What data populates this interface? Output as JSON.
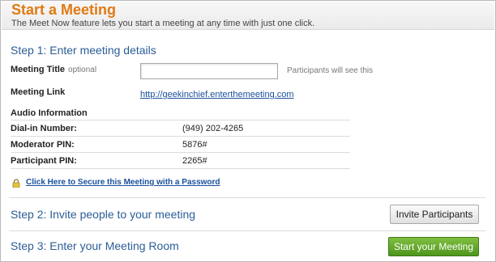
{
  "header": {
    "title": "Start a Meeting",
    "subtitle": "The Meet Now feature lets you start a meeting at any time with just one click."
  },
  "step1": {
    "title": "Step 1: Enter meeting details",
    "meeting_title_label": "Meeting Title",
    "meeting_title_optional": "optional",
    "meeting_title_value": "",
    "meeting_title_hint": "Participants will see this",
    "meeting_link_label": "Meeting Link",
    "meeting_link_url": "http://geekinchief.enterthemeeting.com",
    "audio_heading": "Audio Information",
    "audio_rows": [
      {
        "label": "Dial-in Number:",
        "value": "(949) 202-4265"
      },
      {
        "label": "Moderator PIN:",
        "value": "5876#"
      },
      {
        "label": "Participant PIN:",
        "value": "2265#"
      }
    ],
    "secure_link": "Click Here to Secure this Meeting with a Password"
  },
  "step2": {
    "title": "Step 2: Invite people to your meeting",
    "button": "Invite Participants"
  },
  "step3": {
    "title": "Step 3: Enter your Meeting Room",
    "button": "Start your Meeting"
  },
  "colors": {
    "title_orange": "#e07a12",
    "step_blue": "#2b5d96",
    "link_blue": "#1a4f9c",
    "start_green": "#5aa025"
  },
  "icons": {
    "lock": "lock-icon"
  }
}
